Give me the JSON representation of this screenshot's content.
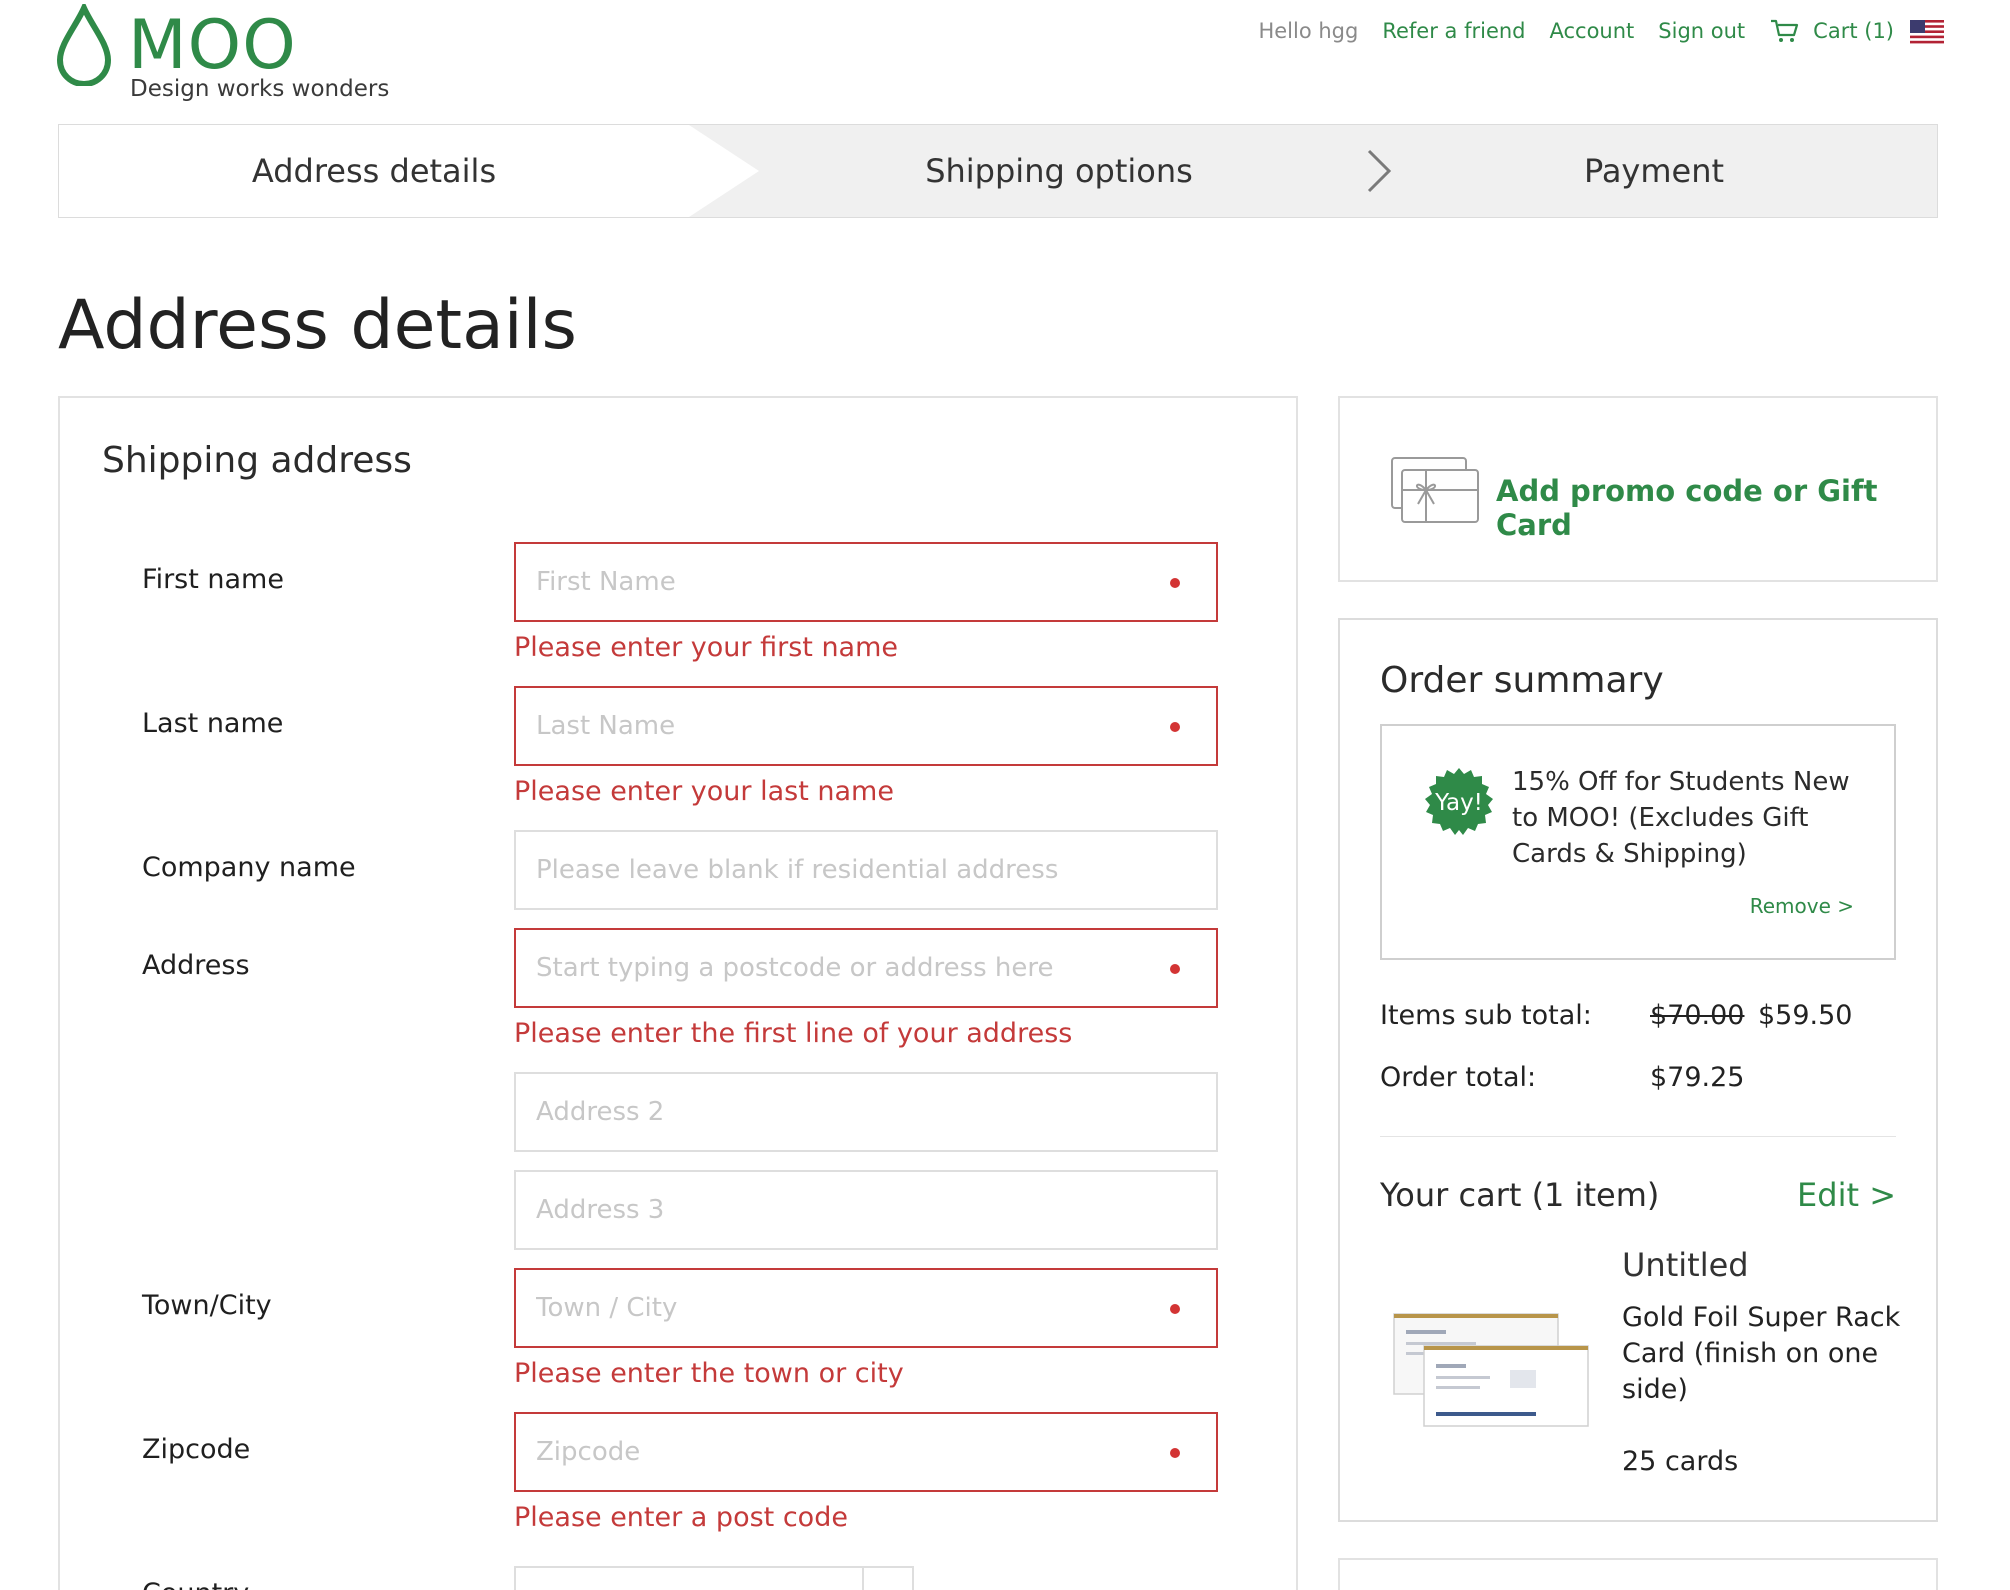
{
  "brand": {
    "name": "MOO",
    "tagline": "Design works wonders",
    "color": "#2f8a48"
  },
  "topnav": {
    "greeting": "Hello hgg",
    "refer": "Refer a friend",
    "account": "Account",
    "sign_out": "Sign out",
    "cart": "Cart (1)",
    "icons": {
      "cart": "cart-icon",
      "flag": "us-flag-icon"
    }
  },
  "steps": [
    {
      "label": "Address details",
      "state": "active"
    },
    {
      "label": "Shipping options",
      "state": "upcoming"
    },
    {
      "label": "Payment",
      "state": "upcoming"
    }
  ],
  "page_title": "Address details",
  "shipping": {
    "title": "Shipping address",
    "first_name": {
      "label": "First name",
      "placeholder": "First Name",
      "error": "Please enter your first name"
    },
    "last_name": {
      "label": "Last name",
      "placeholder": "Last Name",
      "error": "Please enter your last name"
    },
    "company": {
      "label": "Company name",
      "placeholder": "Please leave blank if residential address"
    },
    "address": {
      "label": "Address",
      "placeholder": "Start typing a postcode or address here",
      "error": "Please enter the first line of your address"
    },
    "address2": {
      "placeholder": "Address 2"
    },
    "address3": {
      "placeholder": "Address 3"
    },
    "town": {
      "label": "Town/City",
      "placeholder": "Town / City",
      "error": "Please enter the town or city"
    },
    "zipcode": {
      "label": "Zipcode",
      "placeholder": "Zipcode",
      "error": "Please enter a post code"
    },
    "country": {
      "label": "Country"
    },
    "error_color": "#c43a3a"
  },
  "promo": {
    "label": "Add promo code or Gift Card",
    "icon": "gift-card-icon"
  },
  "summary": {
    "title": "Order summary",
    "discount": {
      "badge": "Yay!",
      "description": "15% Off for Students New to MOO! (Excludes Gift Cards & Shipping)",
      "remove": "Remove >"
    },
    "subtotal_label": "Items sub total:",
    "subtotal_old": "$70.00",
    "subtotal_new": "$59.50",
    "total_label": "Order total:",
    "total": "$79.25",
    "cart_title": "Your cart (1 item)",
    "edit": "Edit >",
    "item": {
      "name": "Untitled",
      "description": "Gold Foil Super Rack Card (finish on one side)",
      "quantity": "25 cards"
    }
  }
}
